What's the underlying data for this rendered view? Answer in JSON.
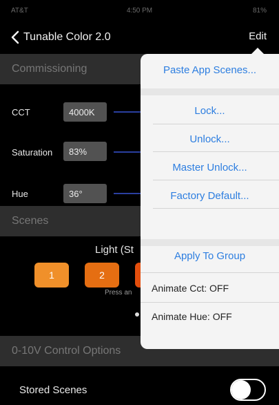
{
  "status": {
    "carrier": "AT&T",
    "time": "4:50 PM",
    "battery": "81%"
  },
  "nav": {
    "back_label": "Tunable Color 2.0",
    "edit_label": "Edit"
  },
  "sections": {
    "commissioning": "Commissioning",
    "scenes": "Scenes",
    "control_options": "0-10V Control Options"
  },
  "controls": [
    {
      "label": "CCT",
      "value": "4000K"
    },
    {
      "label": "Saturation",
      "value": "83%"
    },
    {
      "label": "Hue",
      "value": "36°"
    }
  ],
  "scenes": {
    "title": "Light (St",
    "buttons": [
      "1",
      "2"
    ],
    "hint": "Press an",
    "colors": [
      "#f0902a",
      "#e56e12",
      "#e34e0d"
    ]
  },
  "stored_scenes": {
    "label": "Stored Scenes",
    "enabled": false
  },
  "popover": {
    "paste": "Paste App Scenes...",
    "lock": "Lock...",
    "unlock": "Unlock...",
    "master_unlock": "Master Unlock...",
    "factory_default": "Factory Default...",
    "apply_group": "Apply To Group",
    "animate_cct": "Animate Cct: OFF",
    "animate_hue": "Animate Hue: OFF",
    "accent": "#2d7ee0"
  }
}
